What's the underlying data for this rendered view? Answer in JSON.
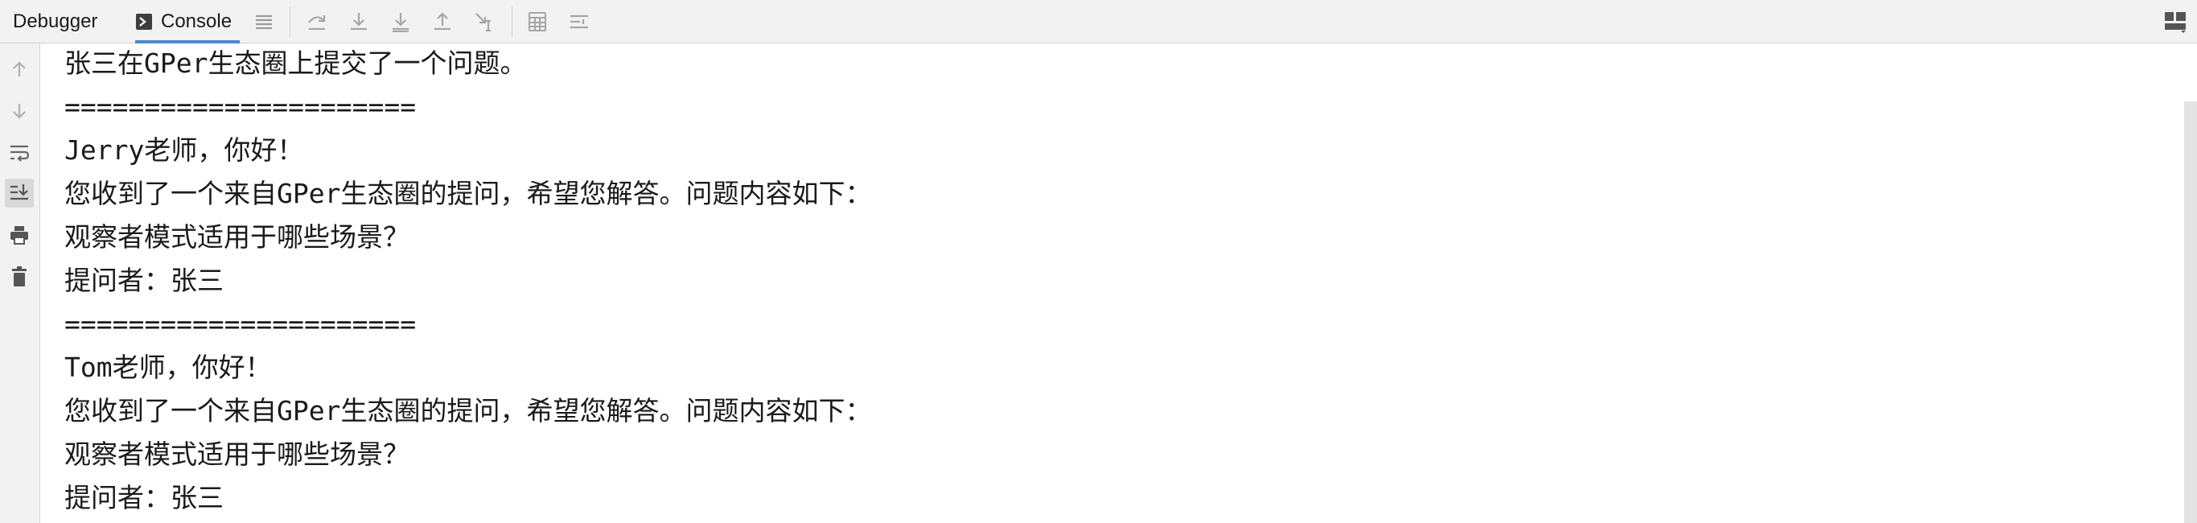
{
  "toolbar": {
    "tabs": [
      {
        "label": "Debugger",
        "active": false
      },
      {
        "label": "Console",
        "active": true
      }
    ],
    "icons": [
      "list-icon",
      "step-over-icon",
      "step-into-icon",
      "force-step-into-icon",
      "step-out-icon",
      "run-to-cursor-icon",
      "evaluate-expression-icon",
      "trace-current-stream-icon"
    ],
    "accent_color": "#4a88c7"
  },
  "gutter": {
    "icons": [
      "up-arrow-icon",
      "down-arrow-icon",
      "soft-wrap-icon",
      "scroll-to-end-icon",
      "print-icon",
      "trash-icon"
    ],
    "active_icon": "scroll-to-end-icon"
  },
  "console": {
    "lines": [
      "张三在GPer生态圈上提交了一个问题。",
      "======================",
      "Jerry老师，你好！",
      "您收到了一个来自GPer生态圈的提问，希望您解答。问题内容如下：",
      "观察者模式适用于哪些场景？",
      "提问者：张三",
      "======================",
      "Tom老师，你好！",
      "您收到了一个来自GPer生态圈的提问，希望您解答。问题内容如下：",
      "观察者模式适用于哪些场景？",
      "提问者：张三"
    ]
  }
}
